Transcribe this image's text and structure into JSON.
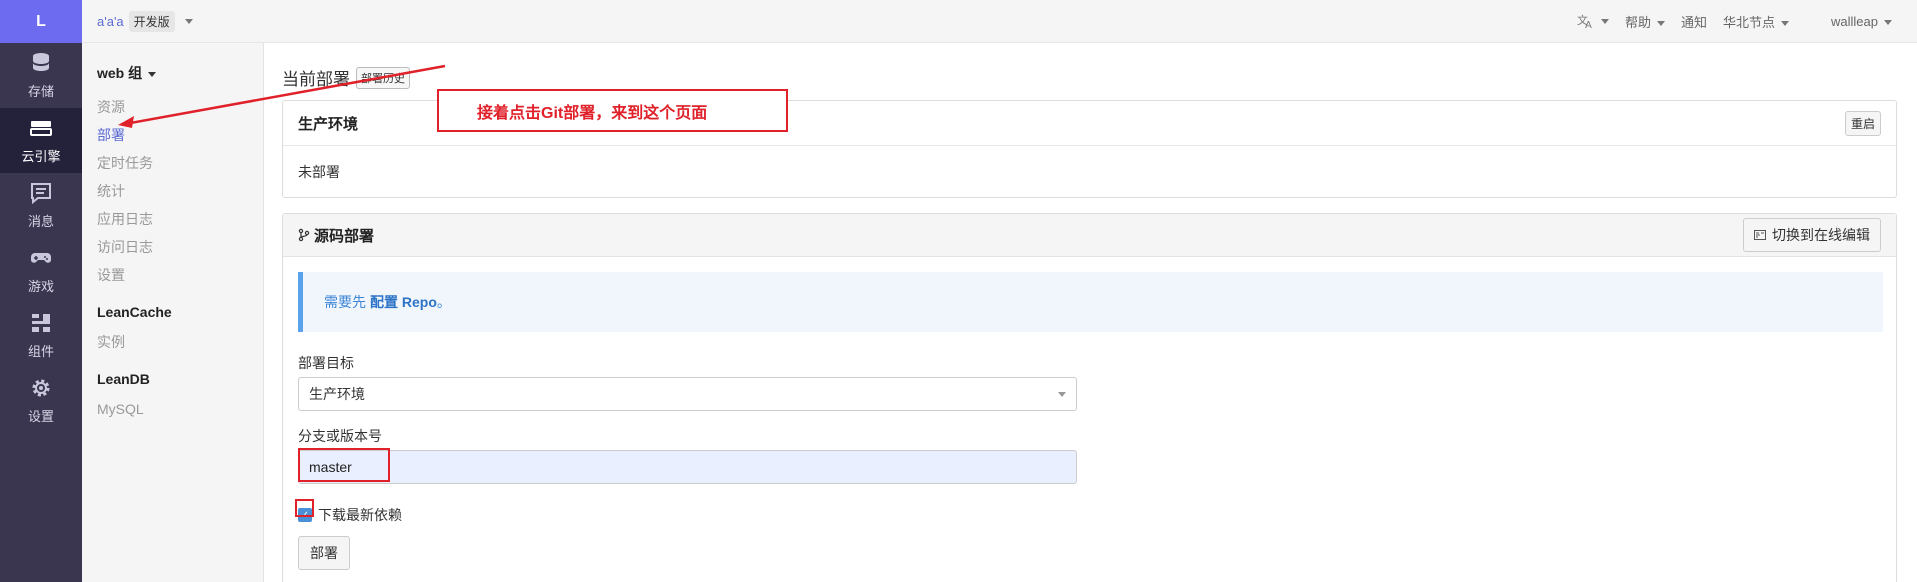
{
  "rail": {
    "logo": "L",
    "items": [
      {
        "label": "存储",
        "icon": "database-icon"
      },
      {
        "label": "云引擎",
        "icon": "engine-icon"
      },
      {
        "label": "消息",
        "icon": "message-icon"
      },
      {
        "label": "游戏",
        "icon": "gamepad-icon"
      },
      {
        "label": "组件",
        "icon": "components-icon"
      },
      {
        "label": "设置",
        "icon": "gear-icon"
      }
    ],
    "active_index": 1
  },
  "topbar": {
    "app_name": "a'a'a",
    "edition": "开发版",
    "translate_icon": "translate-icon",
    "help": "帮助",
    "notify": "通知",
    "region": "华北节点",
    "user": "wallleap"
  },
  "subnav": {
    "group1": "web 组",
    "group1_items": [
      "资源",
      "部署",
      "定时任务",
      "统计",
      "应用日志",
      "访问日志",
      "设置"
    ],
    "active_item": "部署",
    "group2": "LeanCache",
    "group2_items": [
      "实例"
    ],
    "group3": "LeanDB",
    "group3_items": [
      "MySQL"
    ]
  },
  "main": {
    "title": "当前部署",
    "history_button": "部署历史",
    "env_panel": {
      "title": "生产环境",
      "restart_button": "重启",
      "status": "未部署"
    },
    "source_panel": {
      "title": "源码部署",
      "switch_button": "切换到在线编辑",
      "alert_prefix": "需要先",
      "alert_link": "配置 Repo",
      "alert_suffix": "。",
      "target_label": "部署目标",
      "target_value": "生产环境",
      "branch_label": "分支或版本号",
      "branch_value": "master",
      "checkbox_label": "下载最新依赖",
      "checkbox_checked": true,
      "deploy_button": "部署"
    }
  },
  "annotation": {
    "text": "接着点击Git部署，来到这个页面",
    "color": "#e0212a"
  }
}
